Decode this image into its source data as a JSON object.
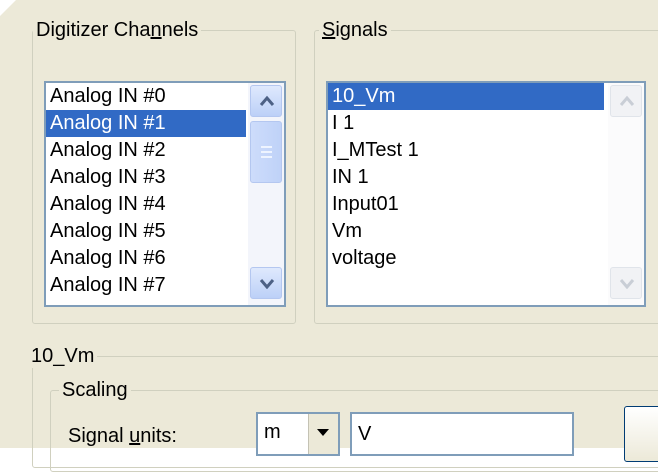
{
  "digitizer_channels": {
    "title_before": "Digitizer Cha",
    "title_mnemonic": "n",
    "title_after": "nels",
    "items": [
      {
        "label": "Analog IN #0",
        "selected": false
      },
      {
        "label": "Analog IN #1",
        "selected": true
      },
      {
        "label": "Analog IN #2",
        "selected": false
      },
      {
        "label": "Analog IN #3",
        "selected": false
      },
      {
        "label": "Analog IN #4",
        "selected": false
      },
      {
        "label": "Analog IN #5",
        "selected": false
      },
      {
        "label": "Analog IN #6",
        "selected": false
      },
      {
        "label": "Analog IN #7",
        "selected": false
      }
    ]
  },
  "signals": {
    "title_mnemonic": "S",
    "title_after": "ignals",
    "items": [
      {
        "label": "10_Vm",
        "selected": true
      },
      {
        "label": "I 1",
        "selected": false
      },
      {
        "label": "I_MTest 1",
        "selected": false
      },
      {
        "label": "IN 1",
        "selected": false
      },
      {
        "label": "Input01",
        "selected": false
      },
      {
        "label": "Vm",
        "selected": false
      },
      {
        "label": "voltage",
        "selected": false
      }
    ]
  },
  "signal_group": {
    "title": "10_Vm",
    "scaling": {
      "title": "Scaling",
      "units_label_before": "Signal ",
      "units_label_mnemonic": "u",
      "units_label_after": "nits:",
      "prefix_value": "m",
      "units_value": "V"
    }
  },
  "colors": {
    "face": "#ece9d8",
    "selection": "#316ac5",
    "border": "#7f9db9"
  }
}
